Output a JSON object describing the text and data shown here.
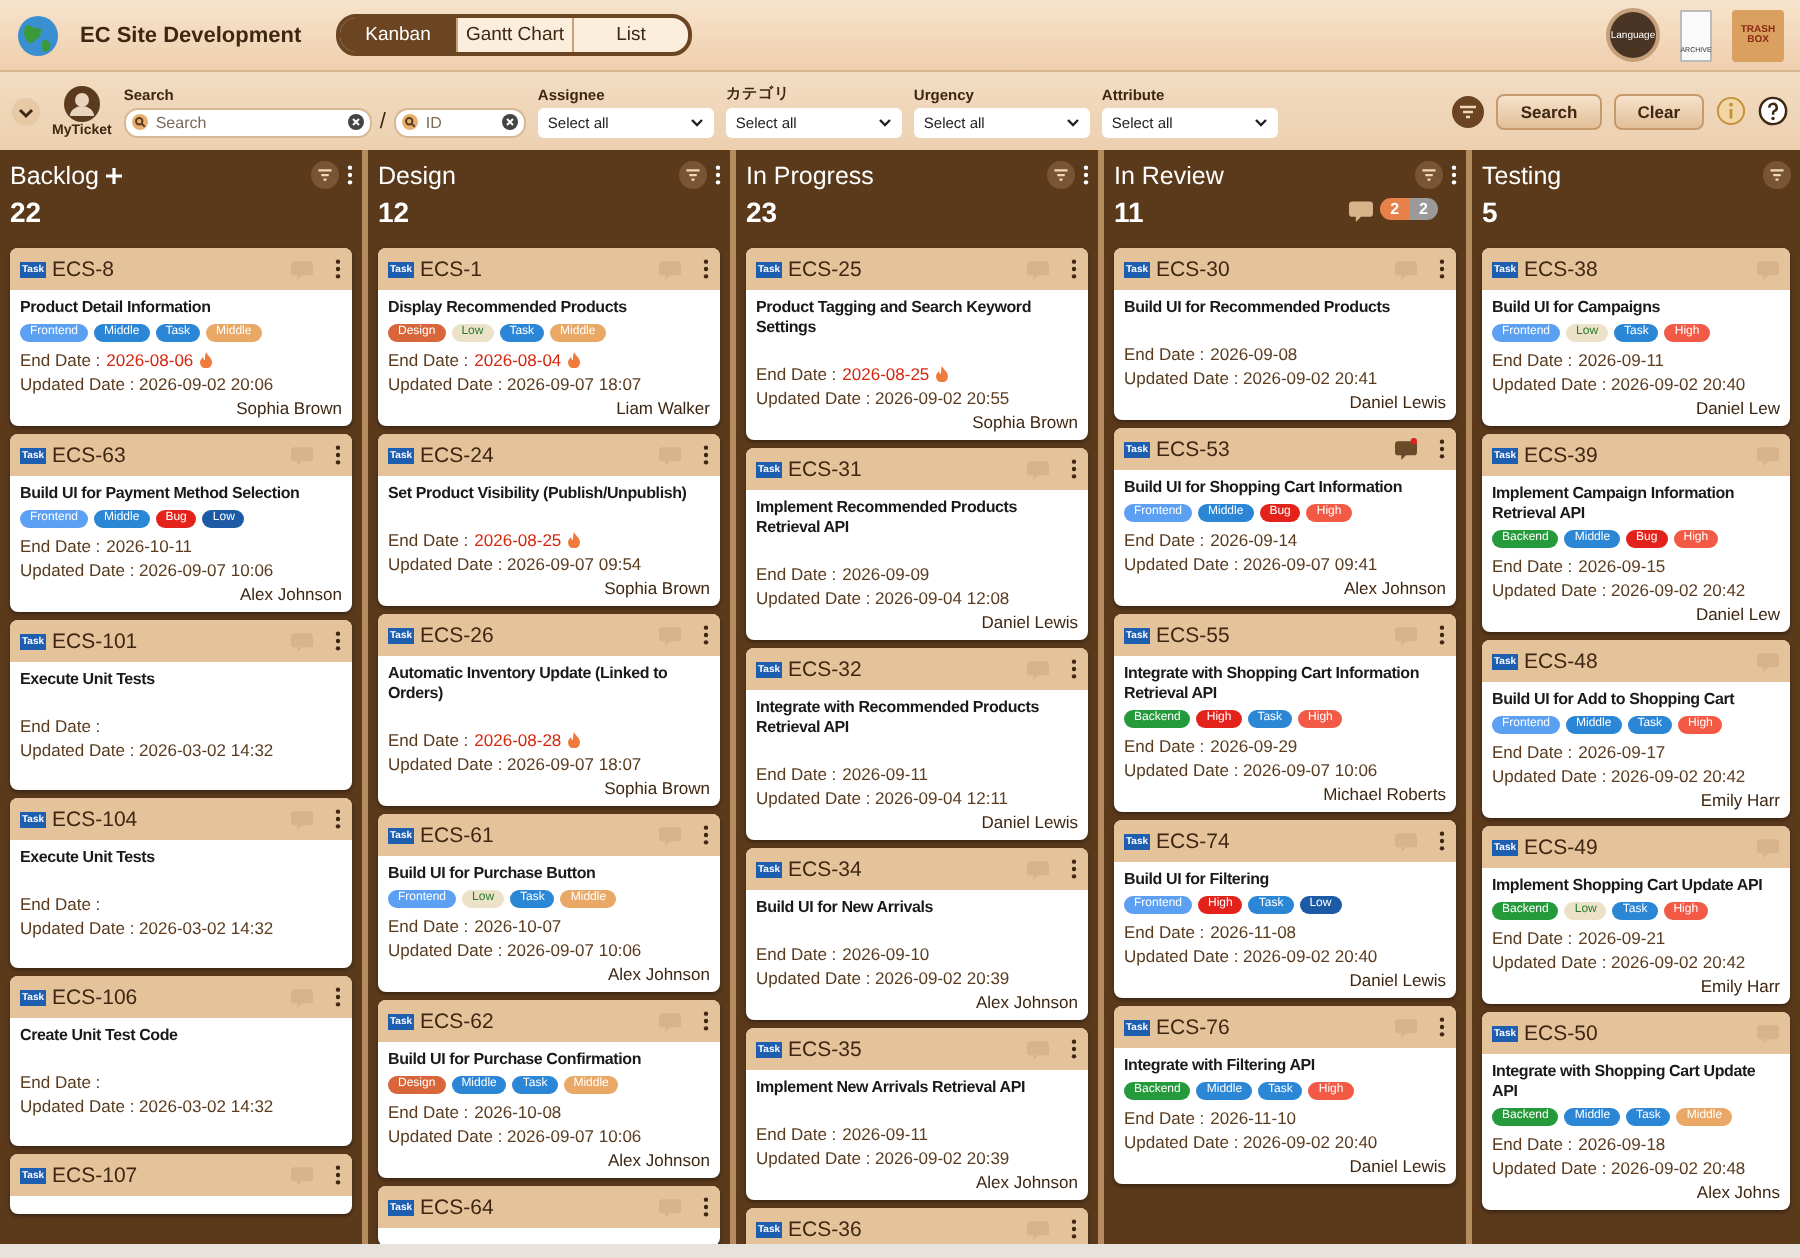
{
  "app": {
    "title": "EC Site Development"
  },
  "view_tabs": [
    {
      "label": "Kanban",
      "selected": true
    },
    {
      "label": "Gantt Chart",
      "selected": false
    },
    {
      "label": "List",
      "selected": false
    }
  ],
  "header_actions": [
    {
      "kind": "language",
      "label": "Language"
    },
    {
      "kind": "archive",
      "label": "ARCHIVE"
    },
    {
      "kind": "trash",
      "label": "TRASH BOX"
    }
  ],
  "filters": {
    "my_ticket": "MyTicket",
    "search_label": "Search",
    "search_placeholder": "Search",
    "separator": "/",
    "id_placeholder": "ID",
    "selects": [
      {
        "label": "Assignee",
        "value": "Select all"
      },
      {
        "label": "カテゴリ",
        "value": "Select all"
      },
      {
        "label": "Urgency",
        "value": "Select all"
      },
      {
        "label": "Attribute",
        "value": "Select all"
      }
    ],
    "buttons": [
      "Search",
      "Clear"
    ]
  },
  "columns": [
    {
      "name": "Backlog",
      "count": "22",
      "can_add": true,
      "menu": true,
      "cards": [
        {
          "type": "Task",
          "id": "ECS-8",
          "title": "Product Detail Information",
          "tags": [
            {
              "label": "Frontend",
              "color": "#5ba0f2"
            },
            {
              "label": "Middle",
              "color": "#2b86d6"
            },
            {
              "label": "Task",
              "color": "#2b86d6"
            },
            {
              "label": "Middle",
              "color": "#e9a866"
            }
          ],
          "end_label": "End Date :",
          "end_date": "2026-08-06",
          "overdue": true,
          "updated": "Updated Date : 2026-09-02 20:06",
          "assignee": "Sophia Brown",
          "new_comment": false
        },
        {
          "type": "Task",
          "id": "ECS-63",
          "title": "Build UI for Payment Method Selection",
          "tags": [
            {
              "label": "Frontend",
              "color": "#5ba0f2"
            },
            {
              "label": "Middle",
              "color": "#2b86d6"
            },
            {
              "label": "Bug",
              "color": "#e3231b"
            },
            {
              "label": "Low",
              "color": "#1c5aa6"
            }
          ],
          "end_label": "End Date :",
          "end_date": "2026-10-11",
          "overdue": false,
          "updated": "Updated Date : 2026-09-07 10:06",
          "assignee": "Alex Johnson",
          "new_comment": false
        },
        {
          "type": "Task",
          "id": "ECS-101",
          "title": "Execute Unit Tests",
          "end_label": "End Date :",
          "overdue": false,
          "updated": "Updated Date : 2026-03-02 14:32",
          "new_comment": false
        },
        {
          "type": "Task",
          "id": "ECS-104",
          "title": "Execute Unit Tests",
          "end_label": "End Date :",
          "overdue": false,
          "updated": "Updated Date : 2026-03-02 14:32",
          "new_comment": false
        },
        {
          "type": "Task",
          "id": "ECS-106",
          "title": "Create Unit Test Code",
          "end_label": "End Date :",
          "overdue": false,
          "updated": "Updated Date : 2026-03-02 14:32",
          "new_comment": false
        },
        {
          "type": "Task",
          "id": "ECS-107",
          "new_comment": false
        }
      ]
    },
    {
      "name": "Design",
      "count": "12",
      "can_add": false,
      "menu": true,
      "cards": [
        {
          "type": "Task",
          "id": "ECS-1",
          "title": "Display Recommended Products",
          "tags": [
            {
              "label": "Design",
              "color": "#d9663a"
            },
            {
              "label": "Low",
              "color": "#ece2c8"
            },
            {
              "label": "Task",
              "color": "#2b86d6"
            },
            {
              "label": "Middle",
              "color": "#e9a866"
            }
          ],
          "end_label": "End Date :",
          "end_date": "2026-08-04",
          "overdue": true,
          "updated": "Updated Date : 2026-09-07 18:07",
          "assignee": "Liam Walker",
          "new_comment": false
        },
        {
          "type": "Task",
          "id": "ECS-24",
          "title": "Set Product Visibility (Publish/Unpublish)",
          "end_label": "End Date :",
          "end_date": "2026-08-25",
          "overdue": true,
          "updated": "Updated Date : 2026-09-07 09:54",
          "assignee": "Sophia Brown",
          "new_comment": false
        },
        {
          "type": "Task",
          "id": "ECS-26",
          "title": "Automatic Inventory Update (Linked to Orders)",
          "end_label": "End Date :",
          "end_date": "2026-08-28",
          "overdue": true,
          "updated": "Updated Date : 2026-09-07 18:07",
          "assignee": "Sophia Brown",
          "new_comment": false
        },
        {
          "type": "Task",
          "id": "ECS-61",
          "title": "Build UI for Purchase Button",
          "tags": [
            {
              "label": "Frontend",
              "color": "#5ba0f2"
            },
            {
              "label": "Low",
              "color": "#ece2c8"
            },
            {
              "label": "Task",
              "color": "#2b86d6"
            },
            {
              "label": "Middle",
              "color": "#e9a866"
            }
          ],
          "end_label": "End Date :",
          "end_date": "2026-10-07",
          "overdue": false,
          "updated": "Updated Date : 2026-09-07 10:06",
          "assignee": "Alex Johnson",
          "new_comment": false
        },
        {
          "type": "Task",
          "id": "ECS-62",
          "title": "Build UI for Purchase Confirmation",
          "tags": [
            {
              "label": "Design",
              "color": "#d9663a"
            },
            {
              "label": "Middle",
              "color": "#2b86d6"
            },
            {
              "label": "Task",
              "color": "#2b86d6"
            },
            {
              "label": "Middle",
              "color": "#e9a866"
            }
          ],
          "end_label": "End Date :",
          "end_date": "2026-10-08",
          "overdue": false,
          "updated": "Updated Date : 2026-09-07 10:06",
          "assignee": "Alex Johnson",
          "new_comment": false
        },
        {
          "type": "Task",
          "id": "ECS-64",
          "new_comment": false
        }
      ]
    },
    {
      "name": "In Progress",
      "count": "23",
      "can_add": false,
      "menu": true,
      "cards": [
        {
          "type": "Task",
          "id": "ECS-25",
          "title": "Product Tagging and Search Keyword Settings",
          "end_label": "End Date :",
          "end_date": "2026-08-25",
          "overdue": true,
          "updated": "Updated Date : 2026-09-02 20:55",
          "assignee": "Sophia Brown",
          "new_comment": false
        },
        {
          "type": "Task",
          "id": "ECS-31",
          "title": "Implement Recommended Products Retrieval API",
          "end_label": "End Date :",
          "end_date": "2026-09-09",
          "overdue": false,
          "updated": "Updated Date : 2026-09-04 12:08",
          "assignee": "Daniel Lewis",
          "new_comment": false
        },
        {
          "type": "Task",
          "id": "ECS-32",
          "title": "Integrate with Recommended Products Retrieval API",
          "end_label": "End Date :",
          "end_date": "2026-09-11",
          "overdue": false,
          "updated": "Updated Date : 2026-09-04 12:11",
          "assignee": "Daniel Lewis",
          "new_comment": false
        },
        {
          "type": "Task",
          "id": "ECS-34",
          "title": "Build UI for New Arrivals",
          "end_label": "End Date :",
          "end_date": "2026-09-10",
          "overdue": false,
          "updated": "Updated Date : 2026-09-02 20:39",
          "assignee": "Alex Johnson",
          "new_comment": false
        },
        {
          "type": "Task",
          "id": "ECS-35",
          "title": "Implement New Arrivals Retrieval API",
          "end_label": "End Date :",
          "end_date": "2026-09-11",
          "overdue": false,
          "updated": "Updated Date : 2026-09-02 20:39",
          "assignee": "Alex Johnson",
          "new_comment": false
        },
        {
          "type": "Task",
          "id": "ECS-36",
          "new_comment": false
        }
      ]
    },
    {
      "name": "In Review",
      "count": "11",
      "can_add": false,
      "menu": true,
      "badges": [
        {
          "label": "2",
          "color": "#e8804a"
        },
        {
          "label": "2",
          "color": "#9a9a9a"
        }
      ],
      "cards": [
        {
          "type": "Task",
          "id": "ECS-30",
          "title": "Build UI for Recommended Products",
          "end_label": "End Date :",
          "end_date": "2026-09-08",
          "overdue": false,
          "updated": "Updated Date : 2026-09-02 20:41",
          "assignee": "Daniel Lewis",
          "new_comment": false
        },
        {
          "type": "Task",
          "id": "ECS-53",
          "title": "Build UI for Shopping Cart Information",
          "tags": [
            {
              "label": "Frontend",
              "color": "#5ba0f2"
            },
            {
              "label": "Middle",
              "color": "#2b86d6"
            },
            {
              "label": "Bug",
              "color": "#e3231b"
            },
            {
              "label": "High",
              "color": "#f25a45"
            }
          ],
          "end_label": "End Date :",
          "end_date": "2026-09-14",
          "overdue": false,
          "updated": "Updated Date : 2026-09-07 09:41",
          "assignee": "Alex Johnson",
          "new_comment": true
        },
        {
          "type": "Task",
          "id": "ECS-55",
          "title": "Integrate with Shopping Cart Information Retrieval API",
          "tags": [
            {
              "label": "Backend",
              "color": "#249a3a"
            },
            {
              "label": "High",
              "color": "#e3231b"
            },
            {
              "label": "Task",
              "color": "#2b86d6"
            },
            {
              "label": "High",
              "color": "#f25a45"
            }
          ],
          "end_label": "End Date :",
          "end_date": "2026-09-29",
          "overdue": false,
          "updated": "Updated Date : 2026-09-07 10:06",
          "assignee": "Michael Roberts",
          "new_comment": false
        },
        {
          "type": "Task",
          "id": "ECS-74",
          "title": "Build UI for Filtering",
          "tags": [
            {
              "label": "Frontend",
              "color": "#5ba0f2"
            },
            {
              "label": "High",
              "color": "#e3231b"
            },
            {
              "label": "Task",
              "color": "#2b86d6"
            },
            {
              "label": "Low",
              "color": "#1c5aa6"
            }
          ],
          "end_label": "End Date :",
          "end_date": "2026-11-08",
          "overdue": false,
          "updated": "Updated Date : 2026-09-02 20:40",
          "assignee": "Daniel Lewis",
          "new_comment": false
        },
        {
          "type": "Task",
          "id": "ECS-76",
          "title": "Integrate with Filtering API",
          "tags": [
            {
              "label": "Backend",
              "color": "#249a3a"
            },
            {
              "label": "Middle",
              "color": "#2b86d6"
            },
            {
              "label": "Task",
              "color": "#2b86d6"
            },
            {
              "label": "High",
              "color": "#f25a45"
            }
          ],
          "end_label": "End Date :",
          "end_date": "2026-11-10",
          "overdue": false,
          "updated": "Updated Date : 2026-09-02 20:40",
          "assignee": "Daniel Lewis",
          "new_comment": false
        }
      ]
    },
    {
      "name": "Testing",
      "count": "5",
      "can_add": false,
      "menu": false,
      "cards": [
        {
          "type": "Task",
          "id": "ECS-38",
          "title": "Build UI for Campaigns",
          "tags": [
            {
              "label": "Frontend",
              "color": "#5ba0f2"
            },
            {
              "label": "Low",
              "color": "#ece2c8"
            },
            {
              "label": "Task",
              "color": "#2b86d6"
            },
            {
              "label": "High",
              "color": "#f25a45"
            }
          ],
          "end_label": "End Date :",
          "end_date": "2026-09-11",
          "overdue": false,
          "updated": "Updated Date : 2026-09-02 20:40",
          "assignee": "Daniel Lew",
          "new_comment": false
        },
        {
          "type": "Task",
          "id": "ECS-39",
          "title": "Implement Campaign Information Retrieval API",
          "tags": [
            {
              "label": "Backend",
              "color": "#249a3a"
            },
            {
              "label": "Middle",
              "color": "#2b86d6"
            },
            {
              "label": "Bug",
              "color": "#e3231b"
            },
            {
              "label": "High",
              "color": "#f25a45"
            }
          ],
          "end_label": "End Date :",
          "end_date": "2026-09-15",
          "overdue": false,
          "updated": "Updated Date : 2026-09-02 20:42",
          "assignee": "Daniel Lew",
          "new_comment": false
        },
        {
          "type": "Task",
          "id": "ECS-48",
          "title": "Build UI for Add to Shopping Cart",
          "tags": [
            {
              "label": "Frontend",
              "color": "#5ba0f2"
            },
            {
              "label": "Middle",
              "color": "#2b86d6"
            },
            {
              "label": "Task",
              "color": "#2b86d6"
            },
            {
              "label": "High",
              "color": "#f25a45"
            }
          ],
          "end_label": "End Date :",
          "end_date": "2026-09-17",
          "overdue": false,
          "updated": "Updated Date : 2026-09-02 20:42",
          "assignee": "Emily Harr",
          "new_comment": false
        },
        {
          "type": "Task",
          "id": "ECS-49",
          "title": "Implement Shopping Cart Update API",
          "tags": [
            {
              "label": "Backend",
              "color": "#249a3a"
            },
            {
              "label": "Low",
              "color": "#ece2c8"
            },
            {
              "label": "Task",
              "color": "#2b86d6"
            },
            {
              "label": "High",
              "color": "#f25a45"
            }
          ],
          "end_label": "End Date :",
          "end_date": "2026-09-21",
          "overdue": false,
          "updated": "Updated Date : 2026-09-02 20:42",
          "assignee": "Emily Harr",
          "new_comment": false
        },
        {
          "type": "Task",
          "id": "ECS-50",
          "title": "Integrate with Shopping Cart Update API",
          "tags": [
            {
              "label": "Backend",
              "color": "#249a3a"
            },
            {
              "label": "Middle",
              "color": "#2b86d6"
            },
            {
              "label": "Task",
              "color": "#2b86d6"
            },
            {
              "label": "Middle",
              "color": "#e9a866"
            }
          ],
          "end_label": "End Date :",
          "end_date": "2026-09-18",
          "overdue": false,
          "updated": "Updated Date : 2026-09-02 20:48",
          "assignee": "Alex Johns",
          "new_comment": false
        }
      ]
    }
  ]
}
